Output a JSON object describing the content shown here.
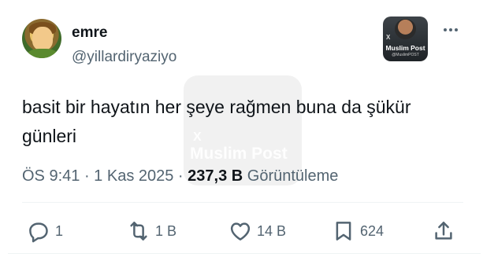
{
  "author": {
    "display_name": "emre",
    "handle": "@yillardiryaziyo"
  },
  "badge": {
    "brand": "Muslim Post",
    "sub": "@MuslimPOST",
    "x_mark": "X"
  },
  "watermark": {
    "x_mark": "X",
    "text": "Muslim Post"
  },
  "tweet": {
    "text": "basit bir hayatın her şeye rağmen buna da şükür günleri"
  },
  "meta": {
    "time": "ÖS 9:41",
    "sep1": " · ",
    "date": "1 Kas 2025",
    "sep2": " · ",
    "views_count": "237,3 B",
    "views_label": " Görüntüleme"
  },
  "actions": {
    "reply_count": "1",
    "retweet_count": "1 B",
    "like_count": "14 B",
    "bookmark_count": "624"
  },
  "icons": {
    "more": "more-icon",
    "reply": "reply-icon",
    "retweet": "retweet-icon",
    "like": "heart-icon",
    "bookmark": "bookmark-icon",
    "share": "share-icon"
  }
}
